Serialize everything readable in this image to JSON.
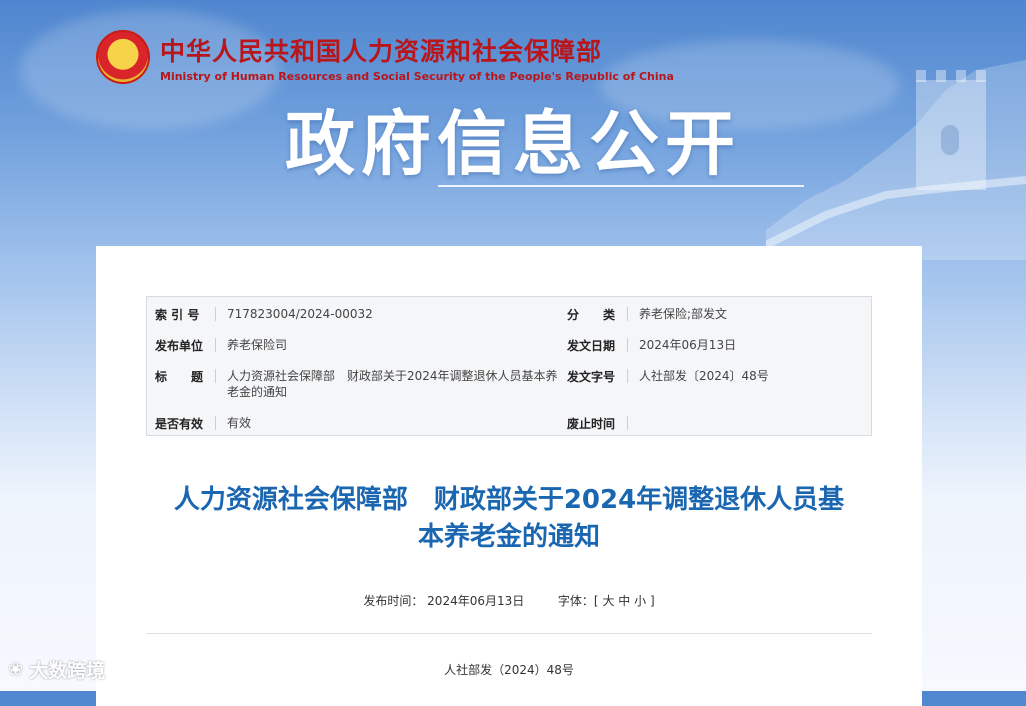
{
  "header": {
    "org_name_cn": "中华人民共和国人力资源和社会保障部",
    "org_name_en": "Ministry of Human Resources and Social Security of the People's Republic of China",
    "emblem_icon": "national-emblem-icon"
  },
  "banner": {
    "title": "政府信息公开"
  },
  "metadata": {
    "index_label": "索 引 号",
    "index_value": "717823004/2024-00032",
    "category_label": "分　　类",
    "category_value": "养老保险;部发文",
    "publisher_label": "发布单位",
    "publisher_value": "养老保险司",
    "issue_date_label": "发文日期",
    "issue_date_value": "2024年06月13日",
    "title_label": "标　　题",
    "title_value": "人力资源社会保障部　财政部关于2024年调整退休人员基本养老金的通知",
    "doc_no_label": "发文字号",
    "doc_no_value": "人社部发〔2024〕48号",
    "valid_label": "是否有效",
    "valid_value": "有效",
    "abolish_label": "废止时间",
    "abolish_value": ""
  },
  "document": {
    "title_line1": "人力资源社会保障部　财政部关于2024年调整退休人员基",
    "title_line2": "本养老金的通知",
    "publish_time_label": "发布时间：",
    "publish_time_value": "2024年06月13日",
    "font_size_label": "字体：[",
    "font_large": "大",
    "font_medium": "中",
    "font_small": "小",
    "font_close": "]",
    "doc_number": "人社部发（2024）48号"
  },
  "watermark": {
    "text": "大数跨境",
    "logo_icon": "dashu-logo-icon"
  },
  "colors": {
    "title_blue": "#1a66b0",
    "brand_red": "#b8161b",
    "banner_blue": "#4f86cf"
  }
}
